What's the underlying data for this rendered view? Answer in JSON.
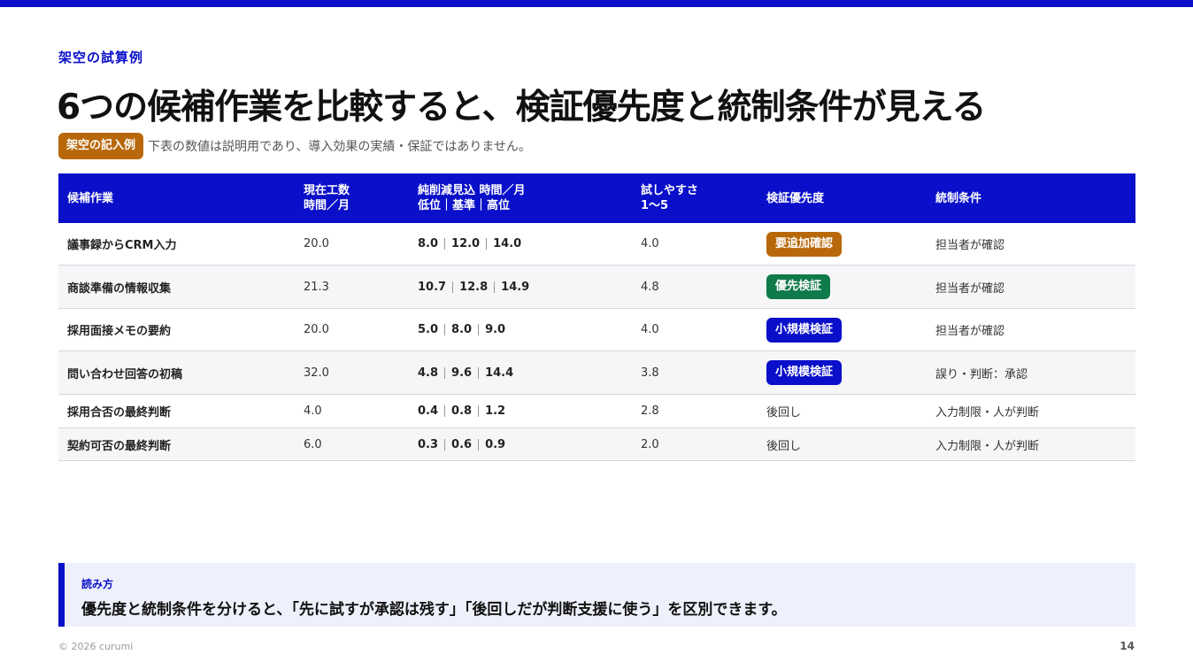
{
  "colors": {
    "accent": "#0a0fc9",
    "badge_orange": "#b8680a",
    "badge_green": "#0f7a4a",
    "badge_blue": "#0a0fc9"
  },
  "header": {
    "eyebrow": "架空の試算例",
    "title": "6つの候補作業を比較すると、検証優先度と統制条件が見える",
    "note_badge": "架空の記入例",
    "note_text": "下表の数値は説明用であり、導入効果の実績・保証ではありません。"
  },
  "table": {
    "headers": [
      [
        "候補作業"
      ],
      [
        "現在工数",
        "時間／月"
      ],
      [
        "純削減見込 時間／月",
        "低位｜基準｜高位"
      ],
      [
        "試しやすさ",
        "1〜5"
      ],
      [
        "検証優先度"
      ],
      [
        "統制条件"
      ]
    ],
    "rows": [
      {
        "task": "議事録からCRM入力",
        "current": "20.0",
        "low": "8.0",
        "base": "12.0",
        "high": "14.0",
        "ease": "4.0",
        "priority": "要追加確認",
        "priority_style": "orange",
        "control": "担当者が確認"
      },
      {
        "task": "商談準備の情報収集",
        "current": "21.3",
        "low": "10.7",
        "base": "12.8",
        "high": "14.9",
        "ease": "4.8",
        "priority": "優先検証",
        "priority_style": "green",
        "control": "担当者が確認"
      },
      {
        "task": "採用面接メモの要約",
        "current": "20.0",
        "low": "5.0",
        "base": "8.0",
        "high": "9.0",
        "ease": "4.0",
        "priority": "小規模検証",
        "priority_style": "blue",
        "control": "担当者が確認"
      },
      {
        "task": "問い合わせ回答の初稿",
        "current": "32.0",
        "low": "4.8",
        "base": "9.6",
        "high": "14.4",
        "ease": "3.8",
        "priority": "小規模検証",
        "priority_style": "blue",
        "control": "誤り・判断：承認"
      },
      {
        "task": "採用合否の最終判断",
        "current": "4.0",
        "low": "0.4",
        "base": "0.8",
        "high": "1.2",
        "ease": "2.8",
        "priority": "後回し",
        "priority_style": "plain",
        "control": "入力制限・人が判断"
      },
      {
        "task": "契約可否の最終判断",
        "current": "6.0",
        "low": "0.3",
        "base": "0.6",
        "high": "0.9",
        "ease": "2.0",
        "priority": "後回し",
        "priority_style": "plain",
        "control": "入力制限・人が判断"
      }
    ]
  },
  "callout": {
    "label": "読み方",
    "text": "優先度と統制条件を分けると、「先に試すが承認は残す」「後回しだが判断支援に使う」を区別できます。"
  },
  "footer": {
    "copyright": "© 2026 curumi",
    "page_number": "14"
  }
}
